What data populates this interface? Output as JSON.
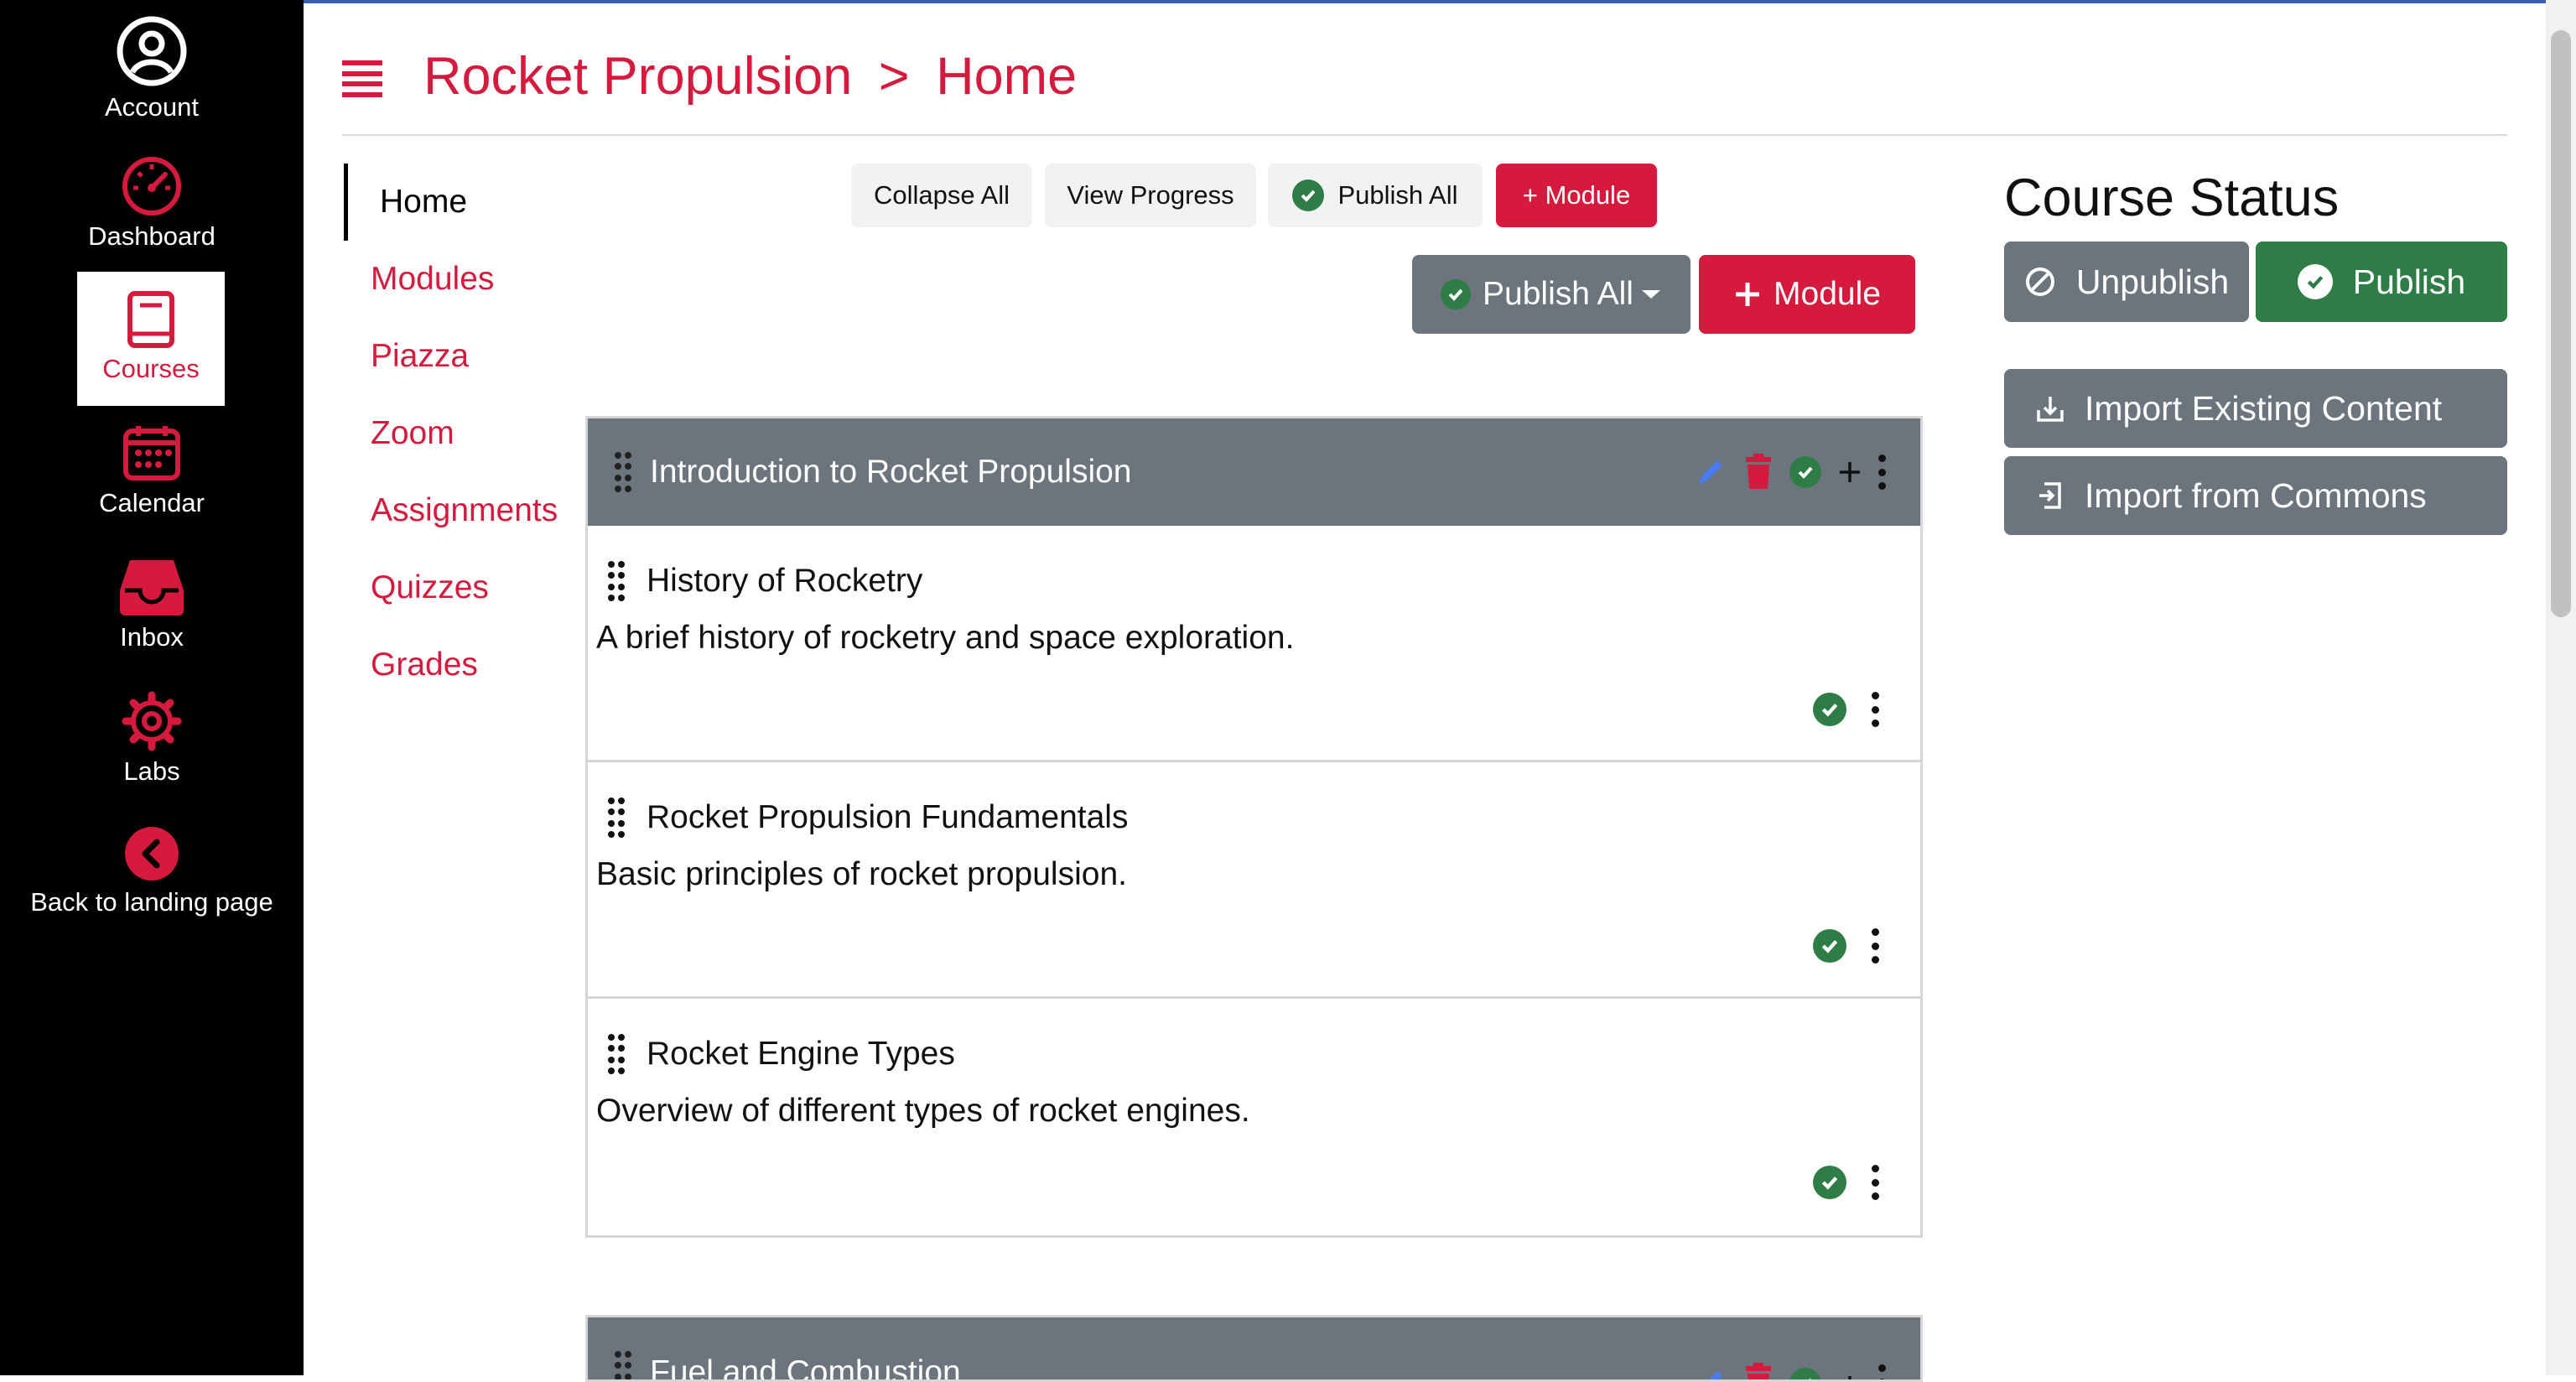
{
  "nav": {
    "items": [
      {
        "label": "Account",
        "icon": "account-circle-icon"
      },
      {
        "label": "Dashboard",
        "icon": "speedometer-icon"
      },
      {
        "label": "Courses",
        "icon": "book-icon"
      },
      {
        "label": "Calendar",
        "icon": "calendar-icon"
      },
      {
        "label": "Inbox",
        "icon": "inbox-icon"
      },
      {
        "label": "Labs",
        "icon": "gear-icon"
      },
      {
        "label": "Back to landing page",
        "icon": "chevron-left-circle-icon"
      }
    ],
    "active": "Courses"
  },
  "header": {
    "course": "Rocket Propulsion",
    "separator": ">",
    "page": "Home"
  },
  "course_nav": {
    "items": [
      "Home",
      "Modules",
      "Piazza",
      "Zoom",
      "Assignments",
      "Quizzes",
      "Grades"
    ],
    "active": "Home"
  },
  "toolbar_small": {
    "collapse_all": "Collapse All",
    "view_progress": "View Progress",
    "publish_all": "Publish All",
    "add_module": "+ Module"
  },
  "toolbar_large": {
    "publish_all": "Publish All",
    "add_module": "Module"
  },
  "modules": [
    {
      "title": "Introduction to Rocket Propulsion",
      "lessons": [
        {
          "title": "History of Rocketry",
          "description": "A brief history of rocketry and space exploration."
        },
        {
          "title": "Rocket Propulsion Fundamentals",
          "description": "Basic principles of rocket propulsion."
        },
        {
          "title": "Rocket Engine Types",
          "description": "Overview of different types of rocket engines."
        }
      ]
    },
    {
      "title": "Fuel and Combustion",
      "lessons": []
    }
  ],
  "course_status": {
    "title": "Course Status",
    "unpublish": "Unpublish",
    "publish": "Publish",
    "import_existing": "Import Existing Content",
    "import_commons": "Import from Commons"
  },
  "colors": {
    "accent": "#d51a3d",
    "nav_bg": "#000000",
    "module_header": "#6c757d",
    "publish_green": "#2e7d46"
  }
}
